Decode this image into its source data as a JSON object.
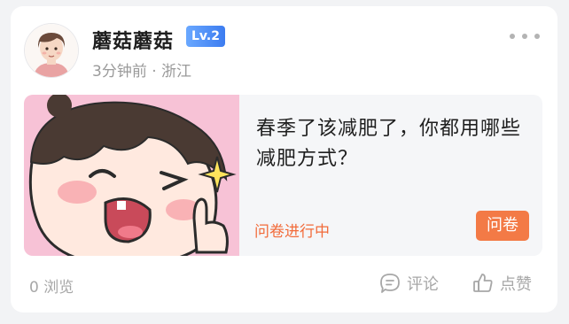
{
  "post": {
    "author": {
      "name": "蘑菇蘑菇",
      "level": "Lv.2",
      "meta": "3分钟前 · 浙江"
    },
    "title": "春季了该减肥了，你都用哪些减肥方式？",
    "status": "问卷进行中",
    "tag": "问卷",
    "views": "0 浏览",
    "actions": {
      "comment": "评论",
      "like": "点赞"
    }
  },
  "colors": {
    "accent": "#f37a46",
    "level_badge": "#3c7cf0",
    "muted_text": "#a7a7a7"
  },
  "icons": [
    "more-icon",
    "comment-icon",
    "like-icon"
  ]
}
